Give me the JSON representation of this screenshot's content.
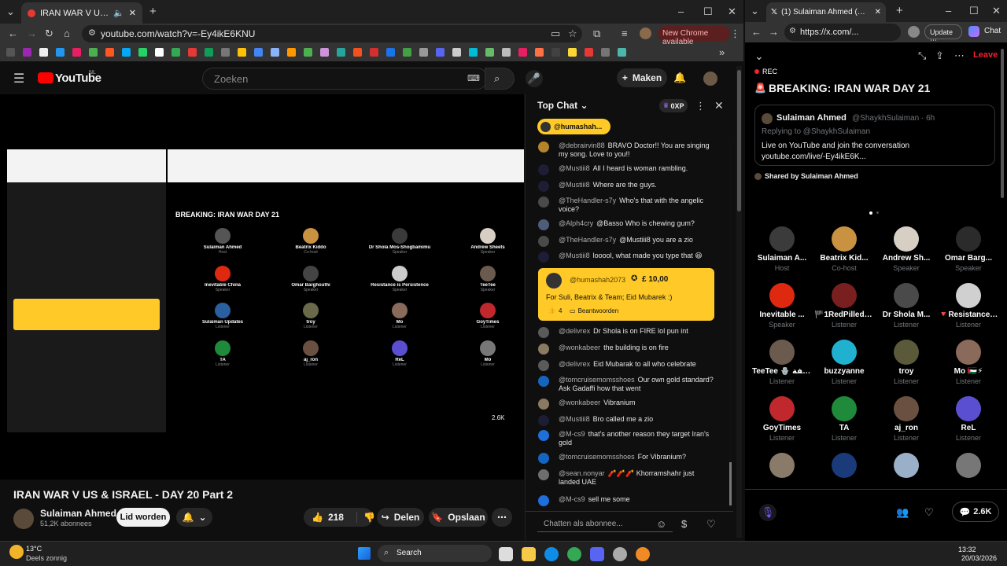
{
  "left_browser": {
    "tab_title": "IRAN WAR V US & ISRAEL",
    "url": "youtube.com/watch?v=-Ey4ikE6KNU",
    "new_chrome": "New Chrome available"
  },
  "youtube": {
    "logo": "YouTube",
    "region": "NL",
    "search_placeholder": "Zoeken",
    "create_label": "Maken",
    "video_title": "IRAN WAR V US & ISRAEL - DAY 20 Part 2",
    "channel_name": "Sulaiman Ahmed",
    "subscribers": "51,2K abonnees",
    "join_label": "Lid worden",
    "likes": "218",
    "share_label": "Delen",
    "save_label": "Opslaan"
  },
  "chat": {
    "header": "Top Chat",
    "xp": "0XP",
    "pinned_user": "@humashah...",
    "input_placeholder": "Chatten als abonnee...",
    "messages_before": [
      {
        "author": "@debrairvin88",
        "text": "BRAVO Doctor!! You are singing my song. Love to you!!",
        "color": "#b5852b"
      },
      {
        "author": "@Mustiii8",
        "text": "All I heard is woman rambling.",
        "color": "#1d1d35"
      },
      {
        "author": "@Mustiii8",
        "text": "Where are the guys.",
        "color": "#1d1d35"
      },
      {
        "author": "@TheHandler-s7y",
        "text": "Who's that with the angelic voice?",
        "color": "#4a4a4a"
      },
      {
        "author": "@Alph4cry",
        "text": "@Basso Who is chewing gum?",
        "color": "#4f5d7a"
      },
      {
        "author": "@TheHandler-s7y",
        "text": "@Mustiii8 you are a zio",
        "color": "#4a4a4a"
      },
      {
        "author": "@Mustiii8",
        "text": "looool, what made you type that 😆",
        "color": "#1d1d35"
      }
    ],
    "superchat": {
      "author": "@humashah2073",
      "amount": "£ 10,00",
      "text": "For Suli, Beatrix & Team; Eid Mubarek :)",
      "likes": "4",
      "reply": "Beantwoorden"
    },
    "messages_after": [
      {
        "author": "@delivrex",
        "text": "Dr Shola is on FIRE lol pun int",
        "color": "#5a5a5a"
      },
      {
        "author": "@wonkabeer",
        "text": "the building is on fire",
        "color": "#8a7a62"
      },
      {
        "author": "@delivrex",
        "text": "Eid Mubarak to all who celebrate",
        "color": "#5a5a5a"
      },
      {
        "author": "@tomcruisemomsshoes",
        "text": "Our own gold standard? Ask Gadaffi how that went",
        "color": "#1565c0"
      },
      {
        "author": "@wonkabeer",
        "text": "Vibranium",
        "color": "#8a7a62"
      },
      {
        "author": "@Mustiii8",
        "text": "Bro called me a zio",
        "color": "#1d1d35"
      },
      {
        "author": "@M-cs9",
        "text": "that's another reason they target Iran's gold",
        "color": "#1e6fd9"
      },
      {
        "author": "@tomcruisemomsshoes",
        "text": "For Vibranium?",
        "color": "#1565c0"
      },
      {
        "author": "@sean.nonyar",
        "text": "🧨🧨🧨 Khorramshahr just landed UAE",
        "color": "#6e6e6e"
      },
      {
        "author": "@M-cs9",
        "text": "sell me some",
        "color": "#1e6fd9"
      }
    ]
  },
  "embedded_space": {
    "breaking": "BREAKING: IRAN WAR DAY 21",
    "speakers": [
      {
        "name": "Sulaiman Ahmed",
        "role": "Host"
      },
      {
        "name": "Beatrix Kiddo",
        "role": "Co-host"
      },
      {
        "name": "Dr Shola Mos-Shogbamimu",
        "role": "Speaker"
      },
      {
        "name": "Andrew Sheets",
        "role": "Speaker"
      },
      {
        "name": "Inevitable China",
        "role": "Speaker"
      },
      {
        "name": "Omar Barghouthi",
        "role": "Speaker"
      },
      {
        "name": "Resistance is Persistence",
        "role": "Speaker"
      },
      {
        "name": "TeeTee",
        "role": "Speaker"
      },
      {
        "name": "Sulaiman Updates",
        "role": "Listener"
      },
      {
        "name": "troy",
        "role": "Listener"
      },
      {
        "name": "Mo",
        "role": "Listener"
      },
      {
        "name": "GoyTimes",
        "role": "Listener"
      },
      {
        "name": "TA",
        "role": "Listener"
      },
      {
        "name": "aj_ron",
        "role": "Listener"
      },
      {
        "name": "ReL",
        "role": "Listener"
      },
      {
        "name": "Mo",
        "role": "Listener"
      }
    ],
    "count": "2.6K"
  },
  "right_browser": {
    "tab_title": "(1) Sulaiman Ahmed (@ShaykhSul",
    "url": "https://x.com/...",
    "update": "Update",
    "chat": "Chat",
    "leave": "Leave",
    "rec": "REC",
    "space_title": "BREAKING: IRAN WAR DAY 21",
    "card_name": "Sulaiman Ahmed",
    "card_handle": "@ShaykhSulaiman · 6h",
    "card_reply": "Replying to @ShaykhSulaiman",
    "card_text1": "Live on YouTube and join the conversation",
    "card_text2": "youtube.com/live/-Ey4ikE6K...",
    "shared_by": "Shared by Sulaiman Ahmed",
    "speakers": [
      {
        "name": "Sulaiman A...",
        "role": "Host",
        "color": "#3b3b3b"
      },
      {
        "name": "Beatrix Kid...",
        "role": "Co-host",
        "color": "#c89240"
      },
      {
        "name": "Andrew Sh...",
        "role": "Speaker",
        "color": "#d8cfc4"
      },
      {
        "name": "Omar Barg...",
        "role": "Speaker",
        "color": "#2b2b2b"
      },
      {
        "name": "Inevitable ...",
        "role": "Speaker",
        "color": "#de2910"
      },
      {
        "name": "🏴1RedPilledO...",
        "role": "Listener",
        "color": "#7a1f1f"
      },
      {
        "name": "Dr Shola M...",
        "role": "Listener",
        "color": "#4a4a4a"
      },
      {
        "name": "🔻Resistance ...",
        "role": "Listener",
        "color": "#d0d0d0"
      },
      {
        "name": "TeeTee 🪬 عاطفة",
        "role": "Listener",
        "color": "#6b5a4e"
      },
      {
        "name": "buzzyanne",
        "role": "Listener",
        "color": "#20b0d0"
      },
      {
        "name": "troy",
        "role": "Listener",
        "color": "#5a5a3a"
      },
      {
        "name": "Mo 🇵🇸⚡",
        "role": "Listener",
        "color": "#8a6a5a"
      },
      {
        "name": "GoyTimes",
        "role": "Listener",
        "color": "#c0282d"
      },
      {
        "name": "TA",
        "role": "Listener",
        "color": "#1e8a3a"
      },
      {
        "name": "aj_ron",
        "role": "Listener",
        "color": "#6a5040"
      },
      {
        "name": "ReL",
        "role": "Listener",
        "color": "#5a4fd0"
      }
    ],
    "count": "2.6K"
  },
  "taskbar": {
    "temp": "13°C",
    "weather": "Deels zonnig",
    "search": "Search",
    "time": "13:32",
    "date": "20/03/2026"
  }
}
